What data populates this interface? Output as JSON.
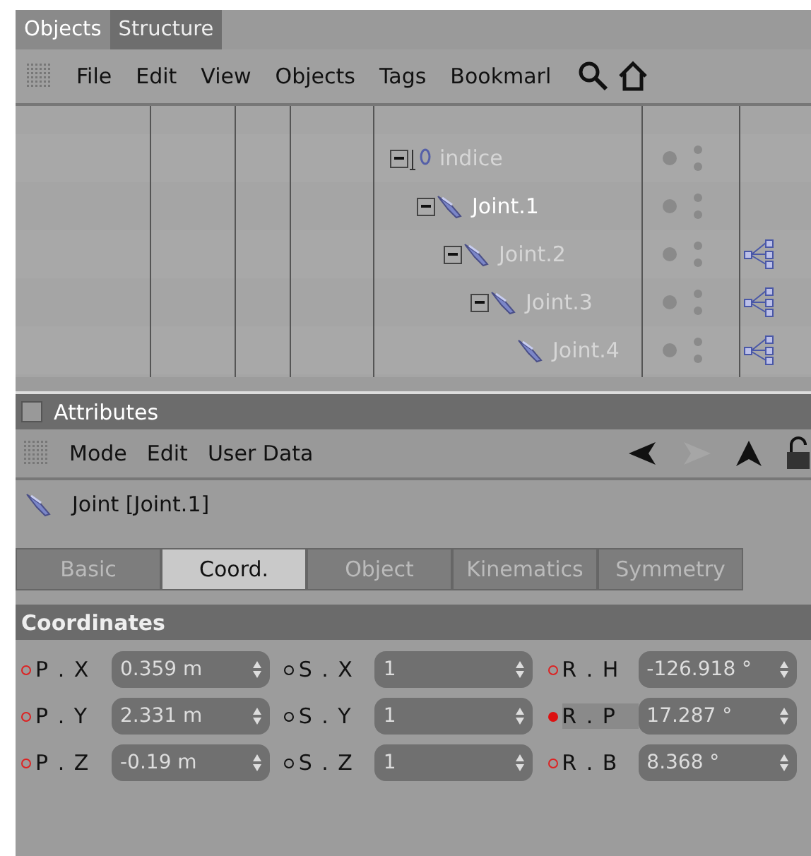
{
  "object_manager": {
    "tabs": [
      {
        "label": "Objects",
        "selected": true
      },
      {
        "label": "Structure",
        "selected": false
      }
    ],
    "menu": [
      "File",
      "Edit",
      "View",
      "Objects",
      "Tags",
      "Bookmarl"
    ],
    "tree": [
      {
        "name": "indice",
        "kind": "null",
        "highlighted": false,
        "ik_tag": false,
        "children": [
          {
            "name": "Joint.1",
            "kind": "joint",
            "highlighted": true,
            "ik_tag": false,
            "children": [
              {
                "name": "Joint.2",
                "kind": "joint",
                "highlighted": false,
                "ik_tag": true,
                "children": [
                  {
                    "name": "Joint.3",
                    "kind": "joint",
                    "highlighted": false,
                    "ik_tag": true,
                    "children": [
                      {
                        "name": "Joint.4",
                        "kind": "joint",
                        "highlighted": false,
                        "ik_tag": true
                      }
                    ]
                  }
                ]
              }
            ]
          }
        ]
      }
    ]
  },
  "attributes": {
    "title": "Attributes",
    "menu": [
      "Mode",
      "Edit",
      "User Data"
    ],
    "object_name": "Joint [Joint.1]",
    "tabs": [
      {
        "label": "Basic",
        "selected": false
      },
      {
        "label": "Coord.",
        "selected": true
      },
      {
        "label": "Object",
        "selected": false
      },
      {
        "label": "Kinematics",
        "selected": false
      },
      {
        "label": "Symmetry",
        "selected": false
      }
    ],
    "section": "Coordinates",
    "rows": [
      [
        {
          "label": "P . X",
          "value": "0.359 m",
          "kind": "animated",
          "highlighted": false
        },
        {
          "label": "S . X",
          "value": "1",
          "kind": "static",
          "highlighted": false
        },
        {
          "label": "R . H",
          "value": "-126.918 °",
          "kind": "animated",
          "highlighted": false
        }
      ],
      [
        {
          "label": "P . Y",
          "value": "2.331 m",
          "kind": "animated",
          "highlighted": false
        },
        {
          "label": "S . Y",
          "value": "1",
          "kind": "static",
          "highlighted": false
        },
        {
          "label": "R . P",
          "value": "17.287 °",
          "kind": "keyframe",
          "highlighted": true
        }
      ],
      [
        {
          "label": "P . Z",
          "value": "-0.19 m",
          "kind": "animated",
          "highlighted": false
        },
        {
          "label": "S . Z",
          "value": "1",
          "kind": "static",
          "highlighted": false
        },
        {
          "label": "R . B",
          "value": "8.368 °",
          "kind": "animated",
          "highlighted": false
        }
      ]
    ]
  }
}
